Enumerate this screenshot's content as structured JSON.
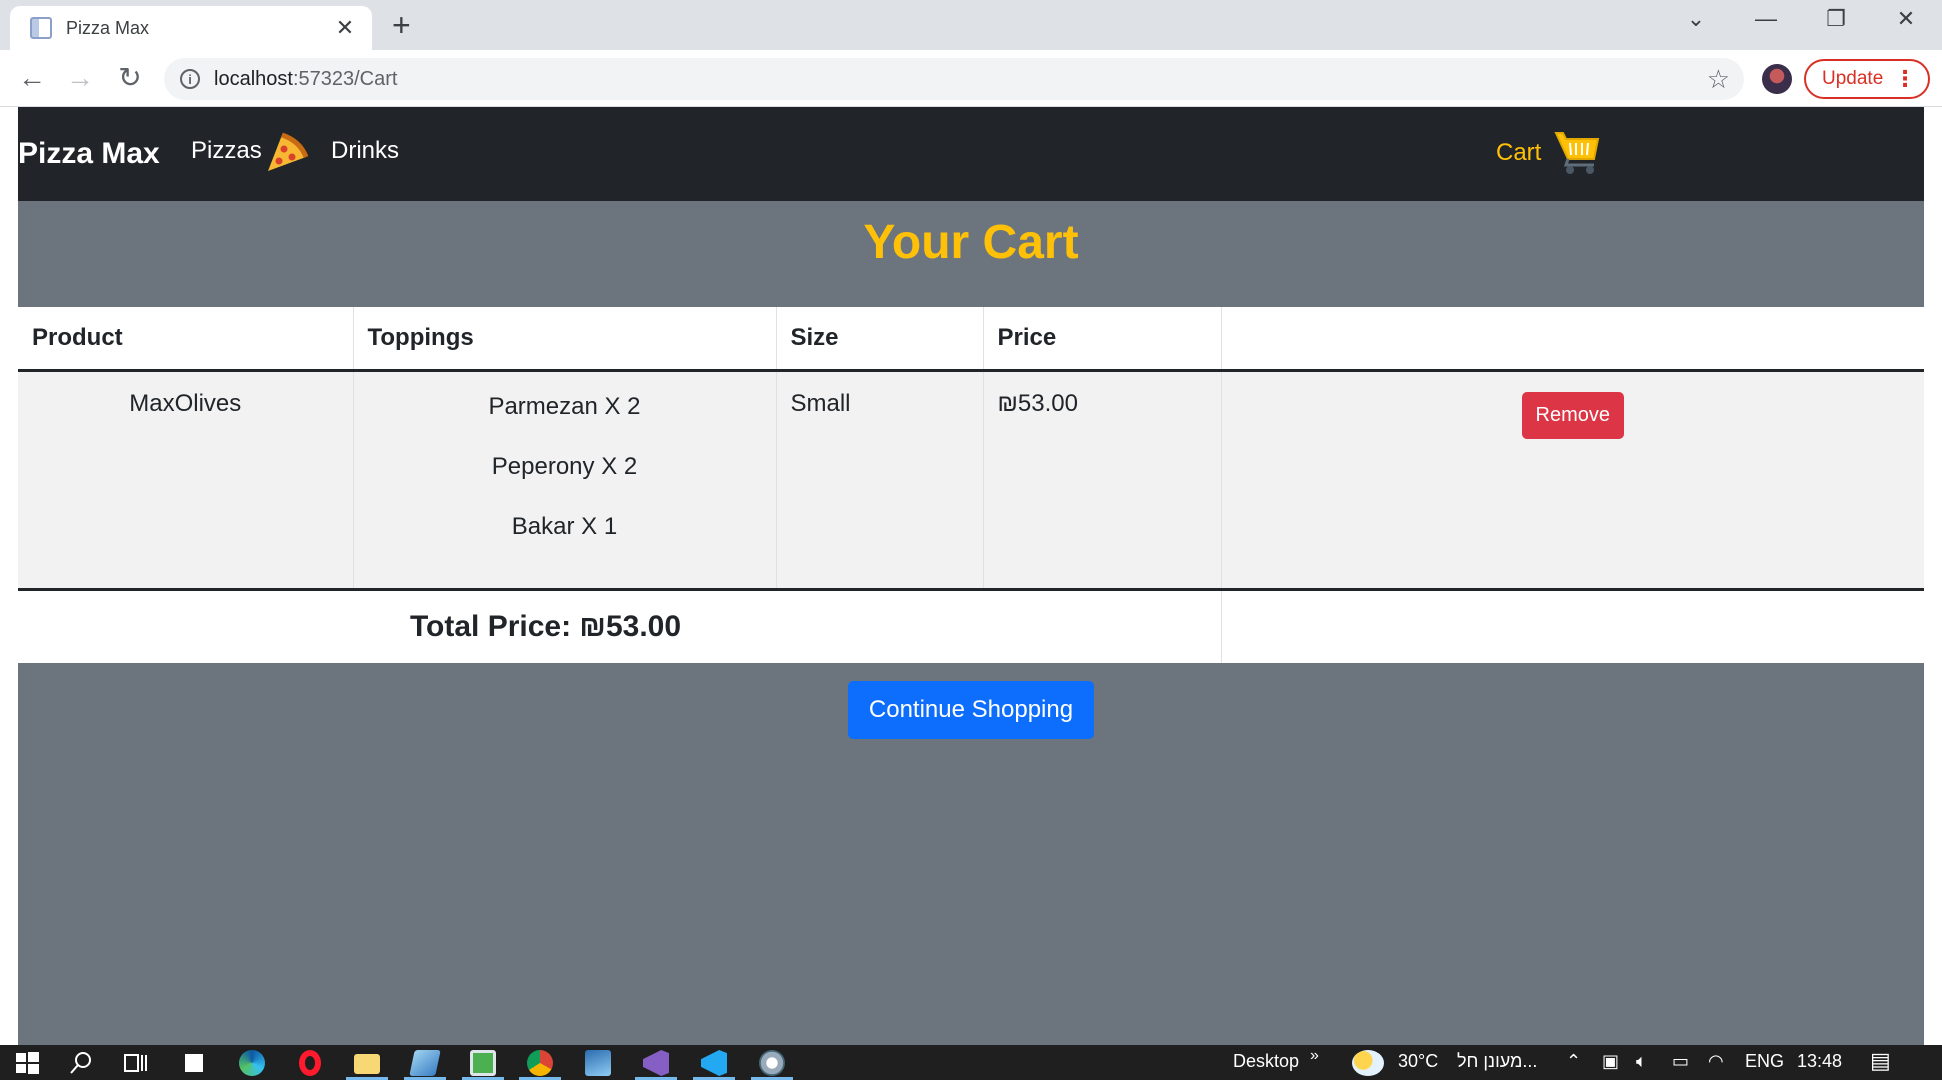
{
  "browser": {
    "tab_title": "Pizza Max",
    "tab_close": "✕",
    "new_tab": "+",
    "url_host": "localhost",
    "url_rest": ":57323/Cart",
    "update_label": "Update"
  },
  "navbar": {
    "brand": "Pizza Max",
    "links": [
      "Pizzas",
      "Drinks"
    ],
    "cart_label": "Cart"
  },
  "page_title": "Your Cart",
  "table": {
    "headers": [
      "Product",
      "Toppings",
      "Size",
      "Price",
      ""
    ],
    "items": [
      {
        "product": "MaxOlives",
        "toppings": [
          "Parmezan X 2",
          "Peperony X 2",
          "Bakar X 1"
        ],
        "size": "Small",
        "price": "₪53.00",
        "action": "Remove"
      }
    ],
    "total_label": "Total Price: ₪53.00"
  },
  "continue_label": "Continue Shopping",
  "taskbar": {
    "desktop_label": "Desktop",
    "weather": "30°C",
    "weather_text": "מעונן חל...",
    "lang": "ENG",
    "time": "13:48"
  },
  "colors": {
    "accent": "#ffc107",
    "page_bg": "#6c757d",
    "navbar_bg": "#212529",
    "danger": "#dc3545",
    "primary": "#0d6efd"
  }
}
